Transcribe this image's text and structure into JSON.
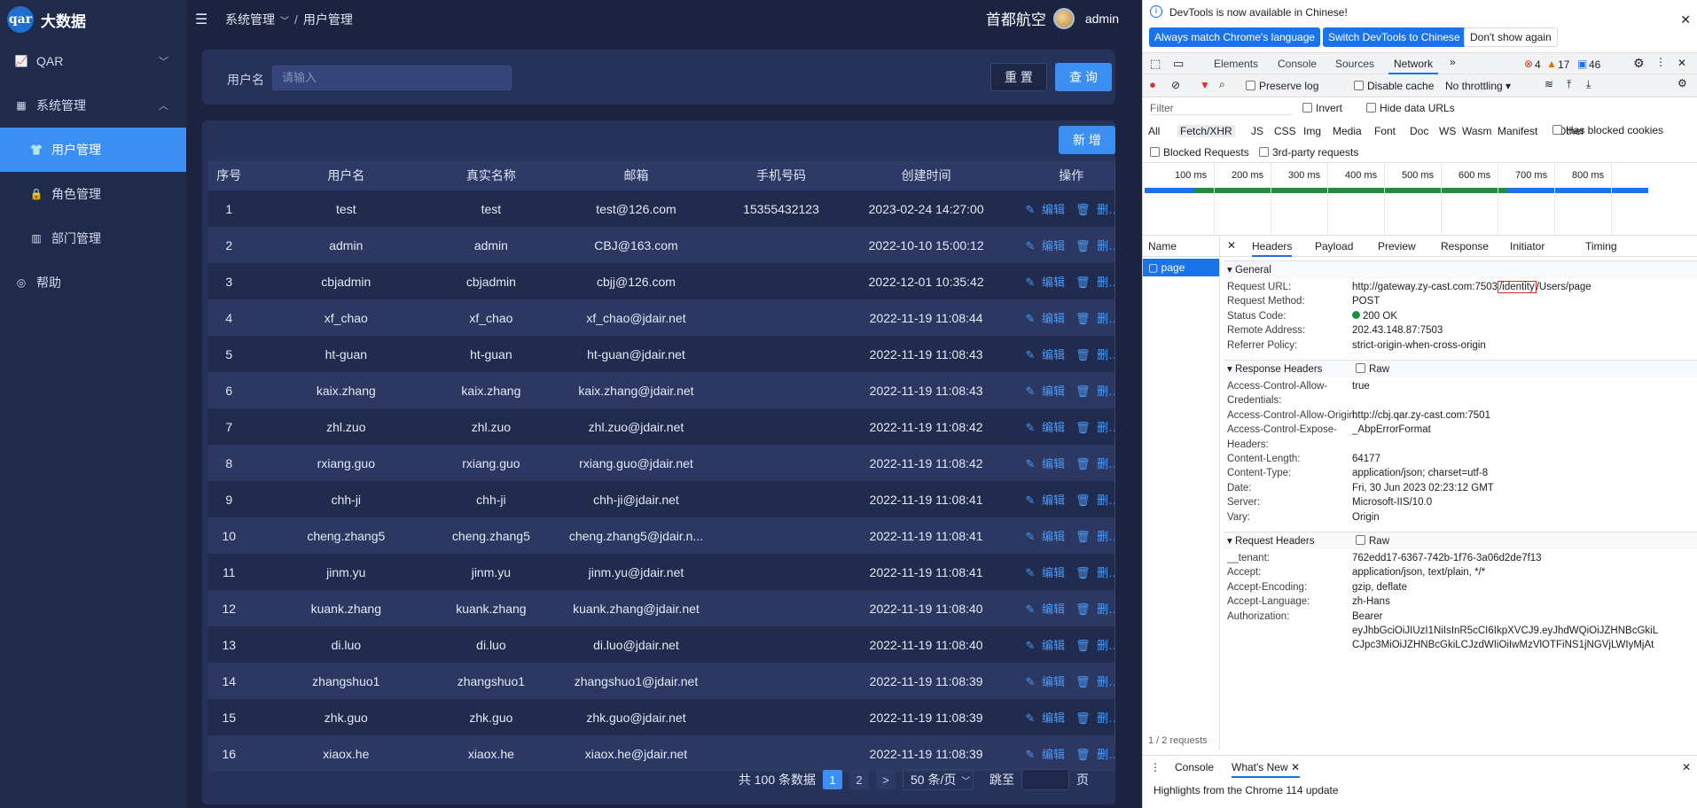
{
  "app": {
    "logo": "qar",
    "title": "大数据",
    "company": "首都航空",
    "user": "admin"
  },
  "sidebar": {
    "items": [
      {
        "label": "QAR",
        "icon": "chart-line-icon",
        "chev": "﹀"
      },
      {
        "label": "系统管理",
        "icon": "grid-icon",
        "chev": "︿"
      },
      {
        "label": "用户管理",
        "icon": "shirt-icon",
        "active": true
      },
      {
        "label": "角色管理",
        "icon": "lock-icon"
      },
      {
        "label": "部门管理",
        "icon": "building-icon"
      },
      {
        "label": "帮助",
        "icon": "help-circle-icon"
      }
    ]
  },
  "breadcrumb": {
    "parent": "系统管理",
    "sep": "/",
    "current": "用户管理"
  },
  "search": {
    "label": "用户名",
    "placeholder": "请输入",
    "reset": "重 置",
    "query": "查 询"
  },
  "table": {
    "add": "新 增",
    "headers": [
      "序号",
      "用户名",
      "真实名称",
      "邮箱",
      "手机号码",
      "创建时间",
      "操作"
    ],
    "edit": "编辑",
    "delete": "删除",
    "rows": [
      [
        "1",
        "test",
        "test",
        "test@126.com",
        "15355432123",
        "2023-02-24 14:27:00"
      ],
      [
        "2",
        "admin",
        "admin",
        "CBJ@163.com",
        "",
        "2022-10-10 15:00:12"
      ],
      [
        "3",
        "cbjadmin",
        "cbjadmin",
        "cbjj@126.com",
        "",
        "2022-12-01 10:35:42"
      ],
      [
        "4",
        "xf_chao",
        "xf_chao",
        "xf_chao@jdair.net",
        "",
        "2022-11-19 11:08:44"
      ],
      [
        "5",
        "ht-guan",
        "ht-guan",
        "ht-guan@jdair.net",
        "",
        "2022-11-19 11:08:43"
      ],
      [
        "6",
        "kaix.zhang",
        "kaix.zhang",
        "kaix.zhang@jdair.net",
        "",
        "2022-11-19 11:08:43"
      ],
      [
        "7",
        "zhl.zuo",
        "zhl.zuo",
        "zhl.zuo@jdair.net",
        "",
        "2022-11-19 11:08:42"
      ],
      [
        "8",
        "rxiang.guo",
        "rxiang.guo",
        "rxiang.guo@jdair.net",
        "",
        "2022-11-19 11:08:42"
      ],
      [
        "9",
        "chh-ji",
        "chh-ji",
        "chh-ji@jdair.net",
        "",
        "2022-11-19 11:08:41"
      ],
      [
        "10",
        "cheng.zhang5",
        "cheng.zhang5",
        "cheng.zhang5@jdair.n...",
        "",
        "2022-11-19 11:08:41"
      ],
      [
        "11",
        "jinm.yu",
        "jinm.yu",
        "jinm.yu@jdair.net",
        "",
        "2022-11-19 11:08:41"
      ],
      [
        "12",
        "kuank.zhang",
        "kuank.zhang",
        "kuank.zhang@jdair.net",
        "",
        "2022-11-19 11:08:40"
      ],
      [
        "13",
        "di.luo",
        "di.luo",
        "di.luo@jdair.net",
        "",
        "2022-11-19 11:08:40"
      ],
      [
        "14",
        "zhangshuo1",
        "zhangshuo1",
        "zhangshuo1@jdair.net",
        "",
        "2022-11-19 11:08:39"
      ],
      [
        "15",
        "zhk.guo",
        "zhk.guo",
        "zhk.guo@jdair.net",
        "",
        "2022-11-19 11:08:39"
      ],
      [
        "16",
        "xiaox.he",
        "xiaox.he",
        "xiaox.he@jdair.net",
        "",
        "2022-11-19 11:08:39"
      ]
    ]
  },
  "pager": {
    "total": "共 100 条数据",
    "page1": "1",
    "page2": "2",
    "next": ">",
    "size": "50 条/页",
    "jump": "跳至",
    "page_unit": "页"
  },
  "devtools": {
    "info": "DevTools is now available in Chinese!",
    "match": "Always match Chrome's language",
    "switch": "Switch DevTools to Chinese",
    "dont": "Don't show again",
    "tabs": [
      "Elements",
      "Console",
      "Sources",
      "Network"
    ],
    "errors": "4",
    "warnings": "17",
    "messages": "46",
    "preserve": "Preserve log",
    "disable_cache": "Disable cache",
    "throttle": "No throttling",
    "filter": "Filter",
    "invert": "Invert",
    "hide_data": "Hide data URLs",
    "types": [
      "All",
      "Fetch/XHR",
      "JS",
      "CSS",
      "Img",
      "Media",
      "Font",
      "Doc",
      "WS",
      "Wasm",
      "Manifest",
      "Other"
    ],
    "blocked_cookies": "Has blocked cookies",
    "blocked_req": "Blocked Requests",
    "third_party": "3rd-party requests",
    "ticks": [
      "100 ms",
      "200 ms",
      "300 ms",
      "400 ms",
      "500 ms",
      "600 ms",
      "700 ms",
      "800 ms"
    ],
    "name_col": "Name",
    "request_name": "page",
    "req_count": "1 / 2 requests",
    "detail_tabs": [
      "Headers",
      "Payload",
      "Preview",
      "Response",
      "Initiator",
      "Timing"
    ],
    "general": "General",
    "response_headers": "Response Headers",
    "request_headers": "Request Headers",
    "raw": "Raw",
    "url_prefix": "http://gateway.zy-cast.com:7503",
    "url_hl": "/identity",
    "url_suffix": "/Users/page",
    "general_rows": [
      [
        "Request URL:",
        ""
      ],
      [
        "Request Method:",
        "POST"
      ],
      [
        "Status Code:",
        "200 OK"
      ],
      [
        "Remote Address:",
        "202.43.148.87:7503"
      ],
      [
        "Referrer Policy:",
        "strict-origin-when-cross-origin"
      ]
    ],
    "resp_rows": [
      [
        "Access-Control-Allow-",
        "true"
      ],
      [
        "Credentials:",
        ""
      ],
      [
        "Access-Control-Allow-Origin:",
        "http://cbj.qar.zy-cast.com:7501"
      ],
      [
        "Access-Control-Expose-",
        "_AbpErrorFormat"
      ],
      [
        "Headers:",
        ""
      ],
      [
        "Content-Length:",
        "64177"
      ],
      [
        "Content-Type:",
        "application/json; charset=utf-8"
      ],
      [
        "Date:",
        "Fri, 30 Jun 2023 02:23:12 GMT"
      ],
      [
        "Server:",
        "Microsoft-IIS/10.0"
      ],
      [
        "Vary:",
        "Origin"
      ]
    ],
    "req_rows": [
      [
        "__tenant:",
        "762edd17-6367-742b-1f76-3a06d2de7f13"
      ],
      [
        "Accept:",
        "application/json, text/plain, */*"
      ],
      [
        "Accept-Encoding:",
        "gzip, deflate"
      ],
      [
        "Accept-Language:",
        "zh-Hans"
      ],
      [
        "Authorization:",
        "Bearer"
      ],
      [
        "",
        "eyJhbGciOiJIUzI1NiIsInR5cCI6IkpXVCJ9.eyJhdWQiOiJZHNBcGkiL"
      ],
      [
        "",
        "CJpc3MiOiJZHNBcGkiLCJzdWIiOiIwMzVlOTFiNS1jNGVjLWIyMjAt"
      ]
    ],
    "drawer_tabs": [
      "Console",
      "What's New"
    ],
    "highlight": "Highlights from the Chrome 114 update"
  }
}
